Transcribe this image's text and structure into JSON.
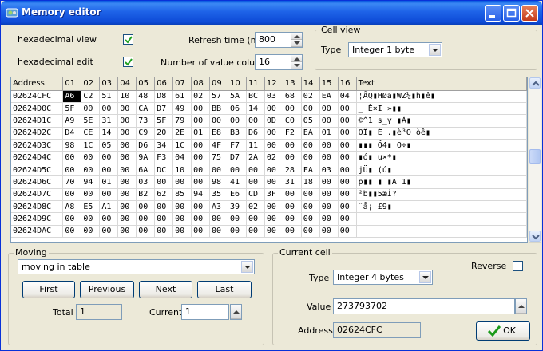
{
  "window": {
    "title": "Memory editor"
  },
  "options": {
    "hex_view_label": "hexadecimal view",
    "hex_edit_label": "hexadecimal edit",
    "refresh_label": "Refresh time (ms)",
    "refresh_value": "800",
    "columns_label": "Number of value columns",
    "columns_value": "16"
  },
  "cell_view": {
    "group_title": "Cell view",
    "type_label": "Type",
    "type_value": "Integer 1 byte"
  },
  "grid": {
    "headers": [
      "Address",
      "01",
      "02",
      "03",
      "04",
      "05",
      "06",
      "07",
      "08",
      "09",
      "10",
      "11",
      "12",
      "13",
      "14",
      "15",
      "16",
      "Text"
    ],
    "rows": [
      [
        "02624CFC",
        "A6",
        "C2",
        "51",
        "10",
        "48",
        "D8",
        "61",
        "02",
        "57",
        "5A",
        "BC",
        "03",
        "68",
        "02",
        "EA",
        "04",
        "¦ÂQ▮HØa▮WZ¼▮h▮ê▮"
      ],
      [
        "02624D0C",
        "5F",
        "00",
        "00",
        "00",
        "CA",
        "D7",
        "49",
        "00",
        "BB",
        "06",
        "14",
        "00",
        "00",
        "00",
        "00",
        "00",
        "_   Ê×I »▮▮"
      ],
      [
        "02624D1C",
        "A9",
        "5E",
        "31",
        "00",
        "73",
        "5F",
        "79",
        "00",
        "00",
        "00",
        "00",
        "0D",
        "C0",
        "05",
        "00",
        "00",
        "©^1 s_y    ▮À▮"
      ],
      [
        "02624D2C",
        "D4",
        "CE",
        "14",
        "00",
        "C9",
        "20",
        "2E",
        "01",
        "E8",
        "B3",
        "D6",
        "00",
        "F2",
        "EA",
        "01",
        "00",
        "ÔÎ▮ É .▮è³Ö òê▮"
      ],
      [
        "02624D3C",
        "98",
        "1C",
        "05",
        "00",
        "D6",
        "34",
        "1C",
        "00",
        "4F",
        "F7",
        "11",
        "00",
        "00",
        "00",
        "00",
        "00",
        "▮▮▮ Ö4▮ O÷▮"
      ],
      [
        "02624D4C",
        "00",
        "00",
        "00",
        "00",
        "9A",
        "F3",
        "04",
        "00",
        "75",
        "D7",
        "2A",
        "02",
        "00",
        "00",
        "00",
        "00",
        "    ▮ó▮ u×*▮"
      ],
      [
        "02624D5C",
        "00",
        "00",
        "00",
        "00",
        "6A",
        "DC",
        "10",
        "00",
        "00",
        "00",
        "00",
        "00",
        "28",
        "FA",
        "03",
        "00",
        "    jÜ▮     (ú▮"
      ],
      [
        "02624D6C",
        "70",
        "94",
        "01",
        "00",
        "03",
        "00",
        "00",
        "00",
        "98",
        "41",
        "00",
        "00",
        "31",
        "18",
        "00",
        "00",
        "p▮▮ ▮   ▮A  1▮"
      ],
      [
        "02624D7C",
        "00",
        "00",
        "00",
        "00",
        "B2",
        "62",
        "85",
        "94",
        "35",
        "E6",
        "CD",
        "3F",
        "00",
        "00",
        "00",
        "00",
        "    ²b▮▮5æÍ?"
      ],
      [
        "02624D8C",
        "A8",
        "E5",
        "A1",
        "00",
        "00",
        "00",
        "00",
        "00",
        "A3",
        "39",
        "02",
        "00",
        "00",
        "00",
        "00",
        "00",
        "¨å¡     £9▮"
      ],
      [
        "02624D9C",
        "00",
        "00",
        "00",
        "00",
        "00",
        "00",
        "00",
        "00",
        "00",
        "00",
        "00",
        "00",
        "00",
        "00",
        "00",
        "00",
        ""
      ],
      [
        "02624DAC",
        "00",
        "00",
        "00",
        "00",
        "00",
        "00",
        "00",
        "00",
        "00",
        "00",
        "00",
        "00",
        "00",
        "00",
        "00",
        "00",
        ""
      ]
    ]
  },
  "moving": {
    "group_title": "Moving",
    "mode_value": "moving in table",
    "first_label": "First",
    "previous_label": "Previous",
    "next_label": "Next",
    "last_label": "Last",
    "total_label": "Total",
    "total_value": "1",
    "current_label": "Current",
    "current_value": "1"
  },
  "current_cell": {
    "group_title": "Current cell",
    "reverse_label": "Reverse",
    "type_label": "Type",
    "type_value": "Integer 4 bytes",
    "value_label": "Value",
    "value_value": "273793702",
    "address_label": "Address",
    "address_value": "02624CFC",
    "ok_label": "OK"
  }
}
